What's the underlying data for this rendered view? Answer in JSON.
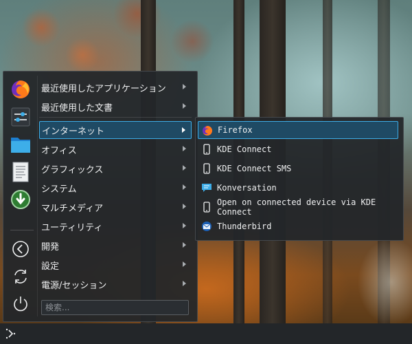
{
  "menu": {
    "categories": [
      {
        "label": "最近使用したアプリケーション",
        "has_submenu": true
      },
      {
        "label": "最近使用した文書",
        "has_submenu": true
      },
      {
        "label": "インターネット",
        "has_submenu": true,
        "active": true
      },
      {
        "label": "オフィス",
        "has_submenu": true
      },
      {
        "label": "グラフィックス",
        "has_submenu": true
      },
      {
        "label": "システム",
        "has_submenu": true
      },
      {
        "label": "マルチメディア",
        "has_submenu": true
      },
      {
        "label": "ユーティリティ",
        "has_submenu": true
      },
      {
        "label": "開発",
        "has_submenu": true
      },
      {
        "label": "設定",
        "has_submenu": true
      },
      {
        "label": "電源/セッション",
        "has_submenu": true
      }
    ],
    "search_placeholder": "検索...",
    "favorites": [
      {
        "icon": "firefox-icon"
      },
      {
        "icon": "system-settings-icon"
      },
      {
        "icon": "folder-icon"
      },
      {
        "icon": "text-editor-icon"
      },
      {
        "icon": "software-center-icon"
      }
    ],
    "session_actions": [
      {
        "icon": "lock-screen-icon"
      },
      {
        "icon": "switch-user-icon"
      },
      {
        "icon": "shutdown-icon"
      }
    ]
  },
  "submenu": {
    "items": [
      {
        "label": "Firefox",
        "icon": "firefox-icon",
        "active": true
      },
      {
        "label": "KDE Connect",
        "icon": "phone-icon"
      },
      {
        "label": "KDE Connect SMS",
        "icon": "phone-icon"
      },
      {
        "label": "Konversation",
        "icon": "chat-icon"
      },
      {
        "label": "Open on connected device via KDE Connect",
        "icon": "phone-icon"
      },
      {
        "label": "Thunderbird",
        "icon": "mail-icon"
      }
    ]
  },
  "taskbar": {
    "launcher_icon": "app-launcher-icon"
  },
  "colors": {
    "accent": "#3daee9",
    "highlight": "#1f4a64",
    "menu_bg": "#232629",
    "text": "#eff0f1"
  }
}
